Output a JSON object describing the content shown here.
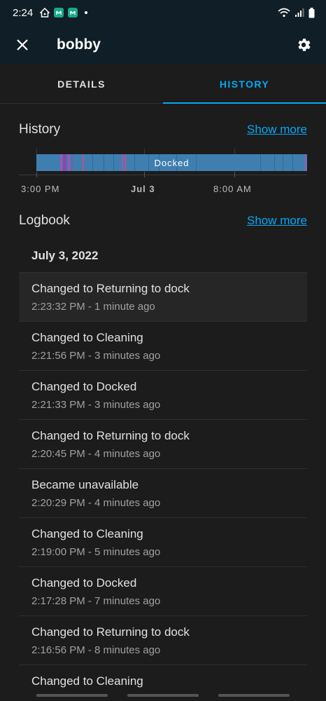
{
  "status_bar": {
    "time": "2:24"
  },
  "app_bar": {
    "title": "bobby"
  },
  "tabs": [
    {
      "label": "DETAILS",
      "active": false
    },
    {
      "label": "HISTORY",
      "active": true
    }
  ],
  "history": {
    "title": "History",
    "show_more": "Show more",
    "state_label": "Docked",
    "axis_labels": [
      "3:00 PM",
      "Jul 3",
      "8:00 AM"
    ],
    "colors": {
      "docked": "#3f7fb0",
      "cleaning": "#9b59b6",
      "returning": "#c0508a",
      "accent": "#03a9f4"
    }
  },
  "logbook": {
    "title": "Logbook",
    "show_more": "Show more",
    "date": "July 3, 2022",
    "entries": [
      {
        "message": "Changed to Returning to dock",
        "time": "2:23:32 PM - 1 minute ago"
      },
      {
        "message": "Changed to Cleaning",
        "time": "2:21:56 PM - 3 minutes ago"
      },
      {
        "message": "Changed to Docked",
        "time": "2:21:33 PM - 3 minutes ago"
      },
      {
        "message": "Changed to Returning to dock",
        "time": "2:20:45 PM - 4 minutes ago"
      },
      {
        "message": "Became unavailable",
        "time": "2:20:29 PM - 4 minutes ago"
      },
      {
        "message": "Changed to Cleaning",
        "time": "2:19:00 PM - 5 minutes ago"
      },
      {
        "message": "Changed to Docked",
        "time": "2:17:28 PM - 7 minutes ago"
      },
      {
        "message": "Changed to Returning to dock",
        "time": "2:16:56 PM - 8 minutes ago"
      },
      {
        "message": "Changed to Cleaning",
        "time": ""
      }
    ]
  }
}
